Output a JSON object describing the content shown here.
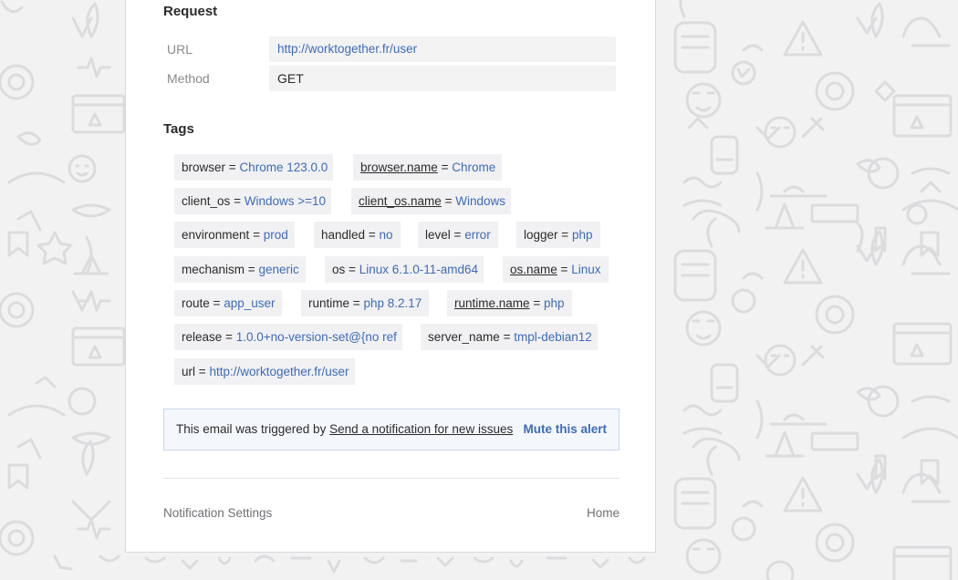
{
  "request": {
    "title": "Request",
    "rows": [
      {
        "label": "URL",
        "value": "http://worktogether.fr/user"
      },
      {
        "label": "Method",
        "value": "GET"
      }
    ]
  },
  "tags": {
    "title": "Tags",
    "items": [
      {
        "key": "browser",
        "value": "Chrome 123.0.0"
      },
      {
        "key": "browser.name",
        "value": "Chrome"
      },
      {
        "key": "client_os",
        "value": "Windows >=10"
      },
      {
        "key": "client_os.name",
        "value": "Windows"
      },
      {
        "key": "environment",
        "value": "prod"
      },
      {
        "key": "handled",
        "value": "no"
      },
      {
        "key": "level",
        "value": "error"
      },
      {
        "key": "logger",
        "value": "php"
      },
      {
        "key": "mechanism",
        "value": "generic"
      },
      {
        "key": "os",
        "value": "Linux 6.1.0-11-amd64"
      },
      {
        "key": "os.name",
        "value": "Linux"
      },
      {
        "key": "route",
        "value": "app_user"
      },
      {
        "key": "runtime",
        "value": "php 8.2.17"
      },
      {
        "key": "runtime.name",
        "value": "php"
      },
      {
        "key": "release",
        "value": "1.0.0+no-version-set@{no ref"
      },
      {
        "key": "server_name",
        "value": "tmpl-debian12"
      },
      {
        "key": "url",
        "value": "http://worktogether.fr/user"
      }
    ],
    "eq": "="
  },
  "alert": {
    "prefix": "This email was triggered by",
    "rule_link": "Send a notification for new issues",
    "mute": "Mute this alert"
  },
  "footer": {
    "settings": "Notification Settings",
    "home": "Home"
  },
  "colors": {
    "link": "#3e6bb7",
    "background": "#f2f2f3",
    "card": "#ffffff"
  }
}
